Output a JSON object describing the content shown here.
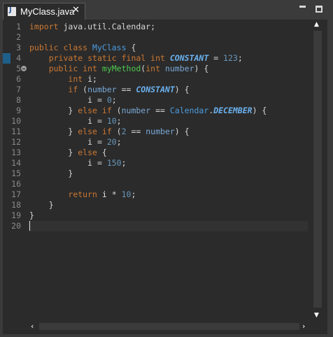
{
  "tab": {
    "icon": "java-file-icon",
    "icon_letter": "J",
    "title": "MyClass.java",
    "close_glyph": "✕"
  },
  "window": {
    "minimize_icon": "minimize-icon",
    "maximize_icon": "maximize-icon"
  },
  "editor": {
    "line_numbers": [
      "1",
      "2",
      "3",
      "4",
      "5",
      "6",
      "7",
      "8",
      "9",
      "10",
      "11",
      "12",
      "13",
      "14",
      "15",
      "16",
      "17",
      "18",
      "19",
      "20"
    ],
    "current_line": 20,
    "lines": [
      [
        [
          "kw",
          "import"
        ],
        [
          "p",
          " java.util.Calendar;"
        ]
      ],
      [],
      [
        [
          "kw",
          "public"
        ],
        [
          "p",
          " "
        ],
        [
          "kw",
          "class"
        ],
        [
          "p",
          " "
        ],
        [
          "cls",
          "MyClass"
        ],
        [
          "p",
          " {"
        ]
      ],
      [
        [
          "p",
          "    "
        ],
        [
          "kw",
          "private"
        ],
        [
          "p",
          " "
        ],
        [
          "kw",
          "static"
        ],
        [
          "p",
          " "
        ],
        [
          "kw",
          "final"
        ],
        [
          "p",
          " "
        ],
        [
          "kw",
          "int"
        ],
        [
          "p",
          " "
        ],
        [
          "cst",
          "CONSTANT"
        ],
        [
          "p",
          " = "
        ],
        [
          "num",
          "123"
        ],
        [
          "p",
          ";"
        ]
      ],
      [
        [
          "p",
          "    "
        ],
        [
          "kw",
          "public"
        ],
        [
          "p",
          " "
        ],
        [
          "kw",
          "int"
        ],
        [
          "p",
          " "
        ],
        [
          "mth",
          "myMethod"
        ],
        [
          "p",
          "("
        ],
        [
          "kw",
          "int"
        ],
        [
          "p",
          " "
        ],
        [
          "var",
          "number"
        ],
        [
          "p",
          ") {"
        ]
      ],
      [
        [
          "p",
          "        "
        ],
        [
          "kw",
          "int"
        ],
        [
          "p",
          " "
        ],
        [
          "loc",
          "i"
        ],
        [
          "p",
          ";"
        ]
      ],
      [
        [
          "p",
          "        "
        ],
        [
          "kw",
          "if"
        ],
        [
          "p",
          " ("
        ],
        [
          "var",
          "number"
        ],
        [
          "p",
          " == "
        ],
        [
          "cst",
          "CONSTANT"
        ],
        [
          "p",
          ") {"
        ]
      ],
      [
        [
          "p",
          "            "
        ],
        [
          "loc",
          "i"
        ],
        [
          "p",
          " = "
        ],
        [
          "num",
          "0"
        ],
        [
          "p",
          ";"
        ]
      ],
      [
        [
          "p",
          "        } "
        ],
        [
          "kw",
          "else"
        ],
        [
          "p",
          " "
        ],
        [
          "kw",
          "if"
        ],
        [
          "p",
          " ("
        ],
        [
          "var",
          "number"
        ],
        [
          "p",
          " == "
        ],
        [
          "cls",
          "Calendar"
        ],
        [
          "p",
          "."
        ],
        [
          "cst",
          "DECEMBER"
        ],
        [
          "p",
          ") {"
        ]
      ],
      [
        [
          "p",
          "            "
        ],
        [
          "loc",
          "i"
        ],
        [
          "p",
          " = "
        ],
        [
          "num",
          "10"
        ],
        [
          "p",
          ";"
        ]
      ],
      [
        [
          "p",
          "        } "
        ],
        [
          "kw",
          "else"
        ],
        [
          "p",
          " "
        ],
        [
          "kw",
          "if"
        ],
        [
          "p",
          " ("
        ],
        [
          "num",
          "2"
        ],
        [
          "p",
          " == "
        ],
        [
          "var",
          "number"
        ],
        [
          "p",
          ") {"
        ]
      ],
      [
        [
          "p",
          "            "
        ],
        [
          "loc",
          "i"
        ],
        [
          "p",
          " = "
        ],
        [
          "num",
          "20"
        ],
        [
          "p",
          ";"
        ]
      ],
      [
        [
          "p",
          "        } "
        ],
        [
          "kw",
          "else"
        ],
        [
          "p",
          " {"
        ]
      ],
      [
        [
          "p",
          "            "
        ],
        [
          "loc",
          "i"
        ],
        [
          "p",
          " = "
        ],
        [
          "num",
          "150"
        ],
        [
          "p",
          ";"
        ]
      ],
      [
        [
          "p",
          "        }"
        ]
      ],
      [],
      [
        [
          "p",
          "        "
        ],
        [
          "kw",
          "return"
        ],
        [
          "p",
          " "
        ],
        [
          "loc",
          "i"
        ],
        [
          "p",
          " * "
        ],
        [
          "num",
          "10"
        ],
        [
          "p",
          ";"
        ]
      ],
      [
        [
          "p",
          "    }"
        ]
      ],
      [
        [
          "p",
          "}"
        ]
      ],
      []
    ]
  },
  "scrollbars": {
    "up": "▲",
    "down": "▼",
    "left": "‹",
    "right": "›"
  },
  "colors": {
    "background": "#2b2b2b",
    "keyword": "#cc7832",
    "class": "#4b9ce0",
    "method": "#4ec94e",
    "constant": "#6bb2f0",
    "number": "#6897bb"
  }
}
